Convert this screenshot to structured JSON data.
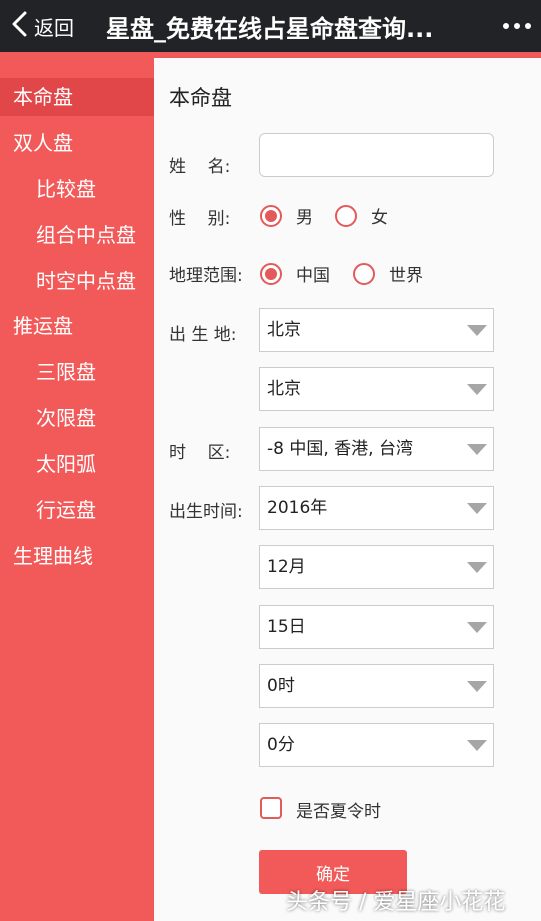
{
  "topbar": {
    "back_label": "返回",
    "title": "星盘_免费在线占星命盘查询..."
  },
  "sidebar": {
    "items": [
      {
        "label": "本命盘"
      },
      {
        "label": "双人盘"
      },
      {
        "label": "比较盘"
      },
      {
        "label": "组合中点盘"
      },
      {
        "label": "时空中点盘"
      },
      {
        "label": "推运盘"
      },
      {
        "label": "三限盘"
      },
      {
        "label": "次限盘"
      },
      {
        "label": "太阳弧"
      },
      {
        "label": "行运盘"
      },
      {
        "label": "生理曲线"
      }
    ]
  },
  "form": {
    "section_title": "本命盘",
    "name_label": "姓    名:",
    "name_value": "",
    "gender_label": "性    别:",
    "gender_options": [
      "男",
      "女"
    ],
    "range_label": "地理范围:",
    "range_options": [
      "中国",
      "世界"
    ],
    "birthplace_label": "出 生 地:",
    "province": "北京",
    "city": "北京",
    "timezone_label": "时    区:",
    "timezone": "-8 中国, 香港, 台湾",
    "birthtime_label": "出生时间:",
    "year": "2016年",
    "month": "12月",
    "day": "15日",
    "hour": "0时",
    "minute": "0分",
    "dst_label": "是否夏令时",
    "submit_label": "确定"
  },
  "watermark": "头条号 / 爱星座小花花",
  "colors": {
    "accent": "#f25a59",
    "sidebar_active": "#e14748",
    "topbar": "#222326"
  }
}
